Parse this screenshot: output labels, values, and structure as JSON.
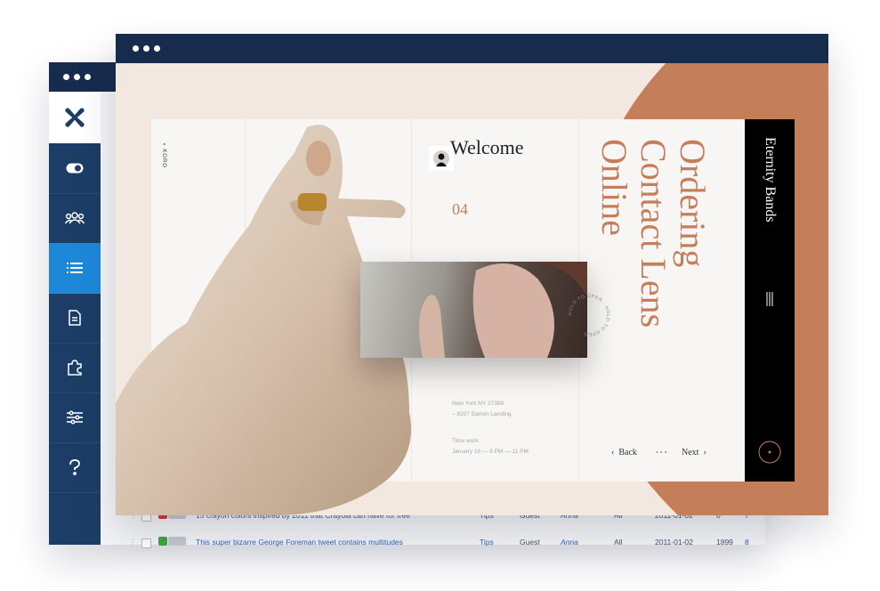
{
  "front_window": {
    "page": {
      "brand": "KORO",
      "welcome": "Welcome",
      "counter": "04",
      "headline": [
        "Ordering",
        "Contact Lens",
        "Online"
      ],
      "address": [
        "New York NY 27389",
        "– 6207 Darren Landing"
      ],
      "hours": [
        "Time work",
        "January 18 — 8 PM — 11 PM"
      ],
      "back_label": "Back",
      "next_label": "Next",
      "side_title": "Eternity Bands",
      "ring_text": "HOLD TO OPEN · HOLD TO OPEN · "
    }
  },
  "back_window": {
    "sidebar": {
      "logo": "joomla-logo-icon",
      "items": [
        "toggle-icon",
        "users-icon",
        "list-icon",
        "document-icon",
        "puzzle-icon",
        "sliders-icon",
        "help-icon"
      ],
      "active_index": 2
    },
    "rows": [
      {
        "title": "15 crayon colors inspired by 2011 that Crayola can have for free",
        "category": "Tips",
        "access": "Guest",
        "author": "Anna",
        "language": "All",
        "date": "2011-01-02",
        "hits": "0",
        "id": "7",
        "status": "unpublished"
      },
      {
        "title": "This super bizarre George Foreman tweet contains multitudes",
        "category": "Tips",
        "access": "Guest",
        "author": "Anna",
        "language": "All",
        "date": "2011-01-02",
        "hits": "1899",
        "id": "8",
        "status": "published"
      }
    ]
  },
  "colors": {
    "navy": "#172b4d",
    "accent": "#c47f5a",
    "active": "#1e88d8"
  }
}
